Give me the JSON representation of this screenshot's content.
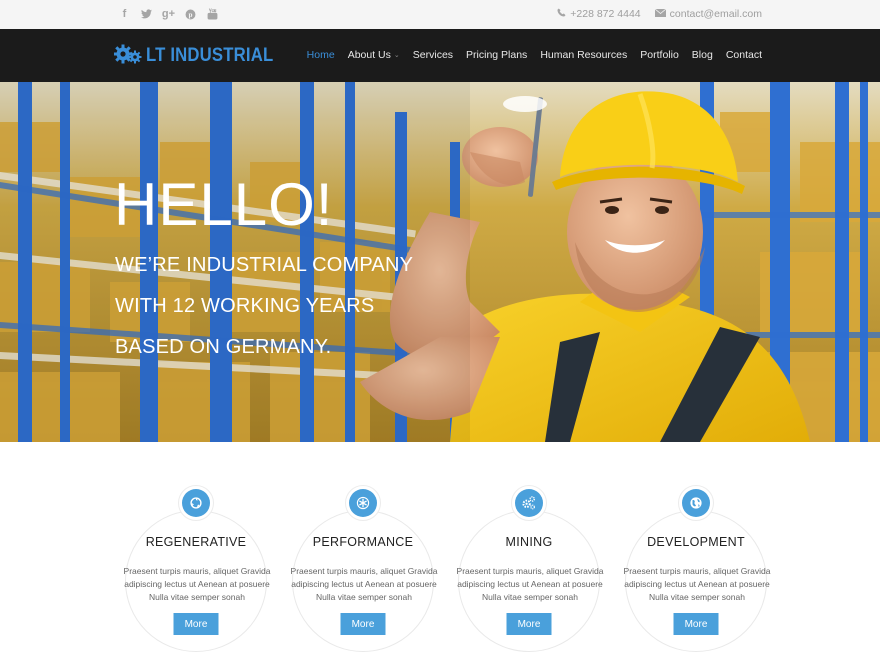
{
  "topbar": {
    "social_icons": [
      "facebook-icon",
      "twitter-icon",
      "google-plus-icon",
      "pinterest-icon",
      "youtube-icon"
    ],
    "phone": "+228 872 4444",
    "email": "contact@email.com"
  },
  "nav": {
    "logo_text": "LT INDUSTRIAL",
    "items": [
      {
        "label": "Home",
        "active": true
      },
      {
        "label": "About Us",
        "dropdown": true
      },
      {
        "label": "Services"
      },
      {
        "label": "Pricing Plans"
      },
      {
        "label": "Human Resources"
      },
      {
        "label": "Portfolio"
      },
      {
        "label": "Blog"
      },
      {
        "label": "Contact"
      }
    ]
  },
  "hero": {
    "title": "HELLO!",
    "lines": [
      "WE’RE INDUSTRIAL COMPANY",
      "WITH 12 WORKING YEARS",
      "BASED ON GERMANY."
    ]
  },
  "services": [
    {
      "title": "REGENERATIVE",
      "text": "Praesent turpis mauris, aliquet Gravida adipiscing lectus ut Aenean at posuere Nulla vitae semper sonah",
      "button": "More",
      "icon": "recycle-icon"
    },
    {
      "title": "PERFORMANCE",
      "text": "Praesent turpis mauris, aliquet Gravida adipiscing lectus ut Aenean at posuere Nulla vitae semper sonah",
      "button": "More",
      "icon": "asterisk-icon"
    },
    {
      "title": "MINING",
      "text": "Praesent turpis mauris, aliquet Gravida adipiscing lectus ut Aenean at posuere Nulla vitae semper sonah",
      "button": "More",
      "icon": "gears-icon"
    },
    {
      "title": "DEVELOPMENT",
      "text": "Praesent turpis mauris, aliquet Gravida adipiscing lectus ut Aenean at posuere Nulla vitae semper sonah",
      "button": "More",
      "icon": "globe-icon"
    }
  ],
  "colors": {
    "accent": "#3a8ed8",
    "button": "#4aa0db",
    "nav_bg": "#1b1b1b",
    "topbar_bg": "#f5f5f5"
  }
}
